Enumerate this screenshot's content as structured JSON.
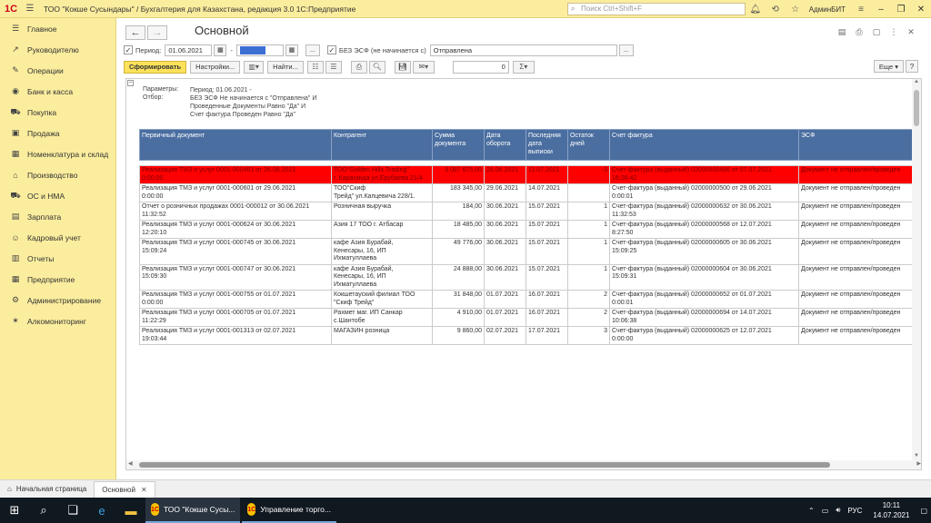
{
  "titlebar": {
    "title": "ТОО \"Кокше Сусындары\" / Бухгалтерия для Казахстана, редакция 3.0 1С:Предприятие",
    "search_placeholder": "Поиск Ctrl+Shift+F",
    "user": "АдминБИТ"
  },
  "sidebar": {
    "items": [
      {
        "label": "Главное",
        "icon": "menu-icon"
      },
      {
        "label": "Руководителю",
        "icon": "trend-icon"
      },
      {
        "label": "Операции",
        "icon": "pencil-icon"
      },
      {
        "label": "Банк и касса",
        "icon": "coin-icon"
      },
      {
        "label": "Покупка",
        "icon": "cart-icon"
      },
      {
        "label": "Продажа",
        "icon": "bag-icon"
      },
      {
        "label": "Номенклатура и склад",
        "icon": "boxes-icon"
      },
      {
        "label": "Производство",
        "icon": "factory-icon"
      },
      {
        "label": "ОС и НМА",
        "icon": "truck-icon"
      },
      {
        "label": "Зарплата",
        "icon": "wallet-icon"
      },
      {
        "label": "Кадровый учет",
        "icon": "people-icon"
      },
      {
        "label": "Отчеты",
        "icon": "chart-icon"
      },
      {
        "label": "Предприятие",
        "icon": "building-icon"
      },
      {
        "label": "Администрирование",
        "icon": "gear-icon"
      },
      {
        "label": "Алкомониторинг",
        "icon": "tools-icon"
      }
    ]
  },
  "form": {
    "title": "Основной",
    "period_label": "Период:",
    "period_from": "01.06.2021",
    "period_dash": "-",
    "esf_label": "БЕЗ ЭСФ (не начинается с)",
    "esf_value": "Отправлена",
    "dots": "...",
    "generate_btn": "Сформировать",
    "settings_btn": "Настройки...",
    "find_btn": "Найти...",
    "sum_value": "0",
    "more_btn": "Еще",
    "help_btn": "?"
  },
  "report": {
    "params_label": "Параметры:",
    "params_value": "Период: 01.06.2021 -",
    "filter_label": "Отбор:",
    "filter_lines": [
      "БЕЗ ЭСФ Не начинается с \"Отправлена\" И",
      "Проведенные Документы Равно \"Да\" И",
      "Счет фактура Проведен Равно \"Да\""
    ],
    "columns": [
      "Первичный документ",
      "Контрагент",
      "Сумма документа",
      "Дата оборота",
      "Последняя дата выписки",
      "Остаток дней",
      "Счет фактура",
      "ЭСФ"
    ],
    "rows": [
      {
        "doc": [
          "Реализация ТМЗ и услуг 0001-000461 от 26.06.2021",
          "0:00:00"
        ],
        "partner": [
          "ТОО\"Golden Hills Trading\"",
          "г. Караганда ул.Ерубаева 21/4"
        ],
        "sum": "3 087 675,00",
        "date": "26.06.2021",
        "last": "11.07.2021",
        "rest": "-3",
        "invoice": [
          "Счет-фактура (выданный) 02000000486 от 07.07.2021",
          "16:26:42"
        ],
        "esf": "Документ не отправлен/проведен"
      },
      {
        "doc": [
          "Реализация ТМЗ и услуг 0001-000601 от 29.06.2021",
          "0:00:00"
        ],
        "partner": [
          "ТОО\"Скиф",
          "Трейд\" ул.Капцевича 228/1."
        ],
        "sum": "183 345,00",
        "date": "29.06.2021",
        "last": "14.07.2021",
        "rest": "",
        "invoice": [
          "Счет-фактура (выданный) 02000000500 от 29.06.2021",
          "0:00:01"
        ],
        "esf": "Документ не отправлен/проведен"
      },
      {
        "doc": [
          "Отчет о розничных продажах 0001-000012 от 30.06.2021",
          "11:32:52"
        ],
        "partner": [
          "Розничная выручка",
          ""
        ],
        "sum": "184,00",
        "date": "30.06.2021",
        "last": "15.07.2021",
        "rest": "1",
        "invoice": [
          "Счет-фактура (выданный) 02000000632 от 30.06.2021",
          "11:32:53"
        ],
        "esf": "Документ не отправлен/проведен"
      },
      {
        "doc": [
          "Реализация ТМЗ и услуг 0001-000624 от 30.06.2021",
          "12:20:10"
        ],
        "partner": [
          "Азия 17 ТОО г. Атбасар",
          ""
        ],
        "sum": "18 485,00",
        "date": "30.06.2021",
        "last": "15.07.2021",
        "rest": "1",
        "invoice": [
          "Счет-фактура (выданный) 02000000568 от 12.07.2021",
          "8:27:50"
        ],
        "esf": "Документ не отправлен/проведен"
      },
      {
        "doc": [
          "Реализация ТМЗ и услуг 0001-000745 от 30.06.2021",
          "15:09:24"
        ],
        "partner": [
          "кафе Азия   Бурабай,",
          "Кенесары, 16, ИП",
          "Ихматуллаева"
        ],
        "sum": "49 776,00",
        "date": "30.06.2021",
        "last": "15.07.2021",
        "rest": "1",
        "invoice": [
          "Счет-фактура (выданный) 02000000605 от 30.06.2021",
          "15:09:25"
        ],
        "esf": "Документ не отправлен/проведен"
      },
      {
        "doc": [
          "Реализация ТМЗ и услуг 0001-000747 от 30.06.2021",
          "15:09:30"
        ],
        "partner": [
          "кафе Азия   Бурабай,",
          "Кенесары, 16, ИП",
          "Ихматуллаева"
        ],
        "sum": "24 888,00",
        "date": "30.06.2021",
        "last": "15.07.2021",
        "rest": "1",
        "invoice": [
          "Счет-фактура (выданный) 02000000604 от 30.06.2021",
          "15:09:31"
        ],
        "esf": "Документ не отправлен/проведен"
      },
      {
        "doc": [
          "Реализация ТМЗ и услуг 0001-000755 от 01.07.2021",
          "0:00:00"
        ],
        "partner": [
          "Кокшетауский филиал ТОО",
          "\"Скиф Трейд\""
        ],
        "sum": "31 848,00",
        "date": "01.07.2021",
        "last": "16.07.2021",
        "rest": "2",
        "invoice": [
          "Счет-фактура (выданный) 02000000652 от 01.07.2021",
          "0:00:01"
        ],
        "esf": "Документ не отправлен/проведен"
      },
      {
        "doc": [
          "Реализация ТМЗ и услуг 0001-000705 от 01.07.2021",
          "11:22:29"
        ],
        "partner": [
          "Рахмет маг. ИП Санкар",
          "с.Шантобе"
        ],
        "sum": "4 910,00",
        "date": "01.07.2021",
        "last": "16.07.2021",
        "rest": "2",
        "invoice": [
          "Счет-фактура (выданный) 02000000694 от 14.07.2021",
          "10:06:38"
        ],
        "esf": "Документ не отправлен/проведен"
      },
      {
        "doc": [
          "Реализация ТМЗ и услуг 0001-001313 от 02.07.2021",
          "19:03:44"
        ],
        "partner": [
          "МАГАЗИН розница",
          ""
        ],
        "sum": "9 860,00",
        "date": "02.07.2021",
        "last": "17.07.2021",
        "rest": "3",
        "invoice": [
          "Счет-фактура (выданный) 02000000625 от 12.07.2021",
          "0:00:00"
        ],
        "esf": "Документ не отправлен/проведен"
      }
    ]
  },
  "tabs": {
    "home": "Начальная страница",
    "current": "Основной"
  },
  "taskbar": {
    "apps": [
      "ТОО \"Кокше Сусы...",
      "Управление торго..."
    ],
    "lang": "РУС",
    "time": "10:11",
    "date": "14.07.2021"
  },
  "colors": {
    "accent_yellow": "#fbed9e",
    "header_blue": "#4a6ea0",
    "highlight_red": "#ff0000"
  }
}
